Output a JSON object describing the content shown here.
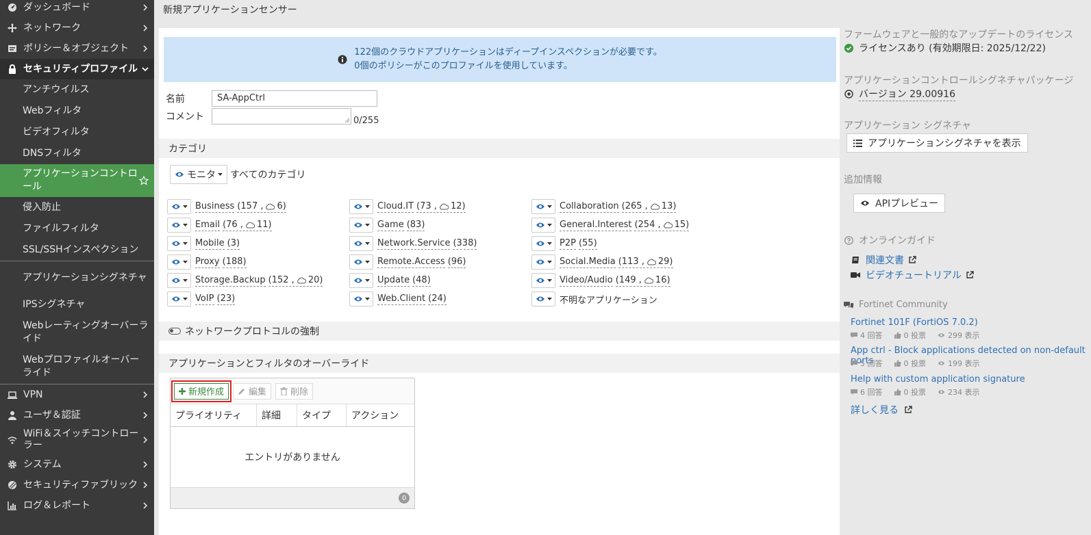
{
  "page_title": "新規アプリケーションセンサー",
  "sidebar": {
    "items": [
      {
        "label": "ダッシュボード",
        "icon": "dashboard-icon"
      },
      {
        "label": "ネットワーク",
        "icon": "network-icon"
      },
      {
        "label": "ポリシー＆オブジェクト",
        "icon": "policy-icon"
      },
      {
        "label": "セキュリティプロファイル",
        "icon": "lock-icon"
      },
      {
        "label": "VPN",
        "icon": "laptop-icon"
      },
      {
        "label": "ユーザ＆認証",
        "icon": "user-icon"
      },
      {
        "label": "WiFi＆スイッチコントローラー",
        "icon": "wifi-icon"
      },
      {
        "label": "システム",
        "icon": "gear-icon"
      },
      {
        "label": "セキュリティファブリック",
        "icon": "fabric-icon"
      },
      {
        "label": "ログ＆レポート",
        "icon": "chart-icon"
      }
    ],
    "subitems": [
      "アンチウイルス",
      "Webフィルタ",
      "ビデオフィルタ",
      "DNSフィルタ",
      "アプリケーションコントロール",
      "侵入防止",
      "ファイルフィルタ",
      "SSL/SSHインスペクション",
      "アプリケーションシグネチャ",
      "IPSシグネチャ",
      "Webレーティングオーバーライド",
      "Webプロファイルオーバーライド"
    ]
  },
  "banner": {
    "line1": "122個のクラウドアプリケーションはディープインスペクションが必要です。",
    "line2": "0個のポリシーがこのプロファイルを使用しています。"
  },
  "form": {
    "name_label": "名前",
    "name_value": "SA-AppCtrl",
    "comment_label": "コメント",
    "comment_count": "0/255"
  },
  "categories": {
    "header": "カテゴリ",
    "monitor_label": "モニタ",
    "all_label": "すべてのカテゴリ",
    "items": [
      {
        "name": "Business",
        "count": "(157 ,",
        "cloud": "6)"
      },
      {
        "name": "Cloud.IT",
        "count": "(73 ,",
        "cloud": "12)"
      },
      {
        "name": "Collaboration",
        "count": "(265 ,",
        "cloud": "13)"
      },
      {
        "name": "Email",
        "count": "(76 ,",
        "cloud": "11)"
      },
      {
        "name": "Game",
        "count": "(83)",
        "cloud": ""
      },
      {
        "name": "General.Interest",
        "count": "(254 ,",
        "cloud": "15)"
      },
      {
        "name": "Mobile",
        "count": "(3)",
        "cloud": ""
      },
      {
        "name": "Network.Service",
        "count": "(338)",
        "cloud": ""
      },
      {
        "name": "P2P",
        "count": "(55)",
        "cloud": ""
      },
      {
        "name": "Proxy",
        "count": "(188)",
        "cloud": ""
      },
      {
        "name": "Remote.Access",
        "count": "(96)",
        "cloud": ""
      },
      {
        "name": "Social.Media",
        "count": "(113 ,",
        "cloud": "29)"
      },
      {
        "name": "Storage.Backup",
        "count": "(152 ,",
        "cloud": "20)"
      },
      {
        "name": "Update",
        "count": "(48)",
        "cloud": ""
      },
      {
        "name": "Video/Audio",
        "count": "(149 ,",
        "cloud": "16)"
      },
      {
        "name": "VoIP",
        "count": "(23)",
        "cloud": ""
      },
      {
        "name": "Web.Client",
        "count": "(24)",
        "cloud": ""
      },
      {
        "name": "不明なアプリケーション",
        "count": "",
        "cloud": ""
      }
    ]
  },
  "protocol": {
    "label": "ネットワークプロトコルの強制"
  },
  "overrides": {
    "header": "アプリケーションとフィルタのオーバーライド",
    "new_label": "新規作成",
    "edit_label": "編集",
    "delete_label": "削除",
    "columns": [
      "プライオリティ",
      "詳細",
      "タイプ",
      "アクション"
    ],
    "empty": "エントリがありません",
    "count": "0"
  },
  "right": {
    "license_heading": "ファームウェアと一般的なアップデートのライセンス",
    "license_status": "ライセンスあり (有効期限日: 2025/12/22)",
    "pkg_heading": "アプリケーションコントロールシグネチャパッケージ",
    "pkg_version": "バージョン 29.00916",
    "sig_heading": "アプリケーション シグネチャ",
    "sig_button": "アプリケーションシグネチャを表示",
    "extra_heading": "追加情報",
    "api_button": "APIプレビュー",
    "guide_heading": "オンラインガイド",
    "doc_link": "関連文書",
    "video_link": "ビデオチュートリアル",
    "community_heading": "Fortinet Community",
    "posts": [
      {
        "title": "Fortinet 101F (FortiOS 7.0.2)",
        "replies": "4 回答",
        "votes": "0 投票",
        "views": "299 表示"
      },
      {
        "title": "App ctrl - Block applications detected on non-default ports",
        "replies": "5 回答",
        "votes": "0 投票",
        "views": "199 表示"
      },
      {
        "title": "Help with custom application signature",
        "replies": "6 回答",
        "votes": "0 投票",
        "views": "234 表示"
      }
    ],
    "more_link": "詳しく見る"
  },
  "colors": {
    "accent_green": "#4c9a4f",
    "link_blue": "#2d6fb5",
    "banner_bg": "#cfe4f9",
    "highlight_red": "#e02020"
  }
}
